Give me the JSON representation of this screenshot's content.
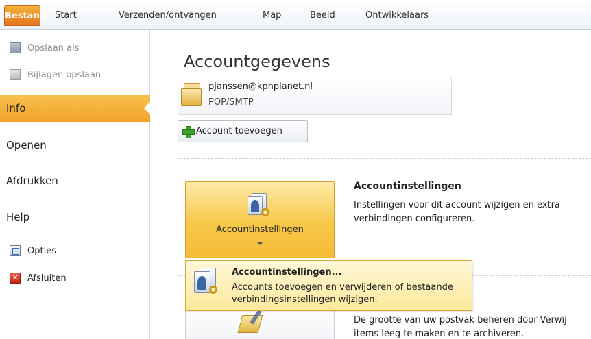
{
  "ribbon": {
    "tabs": [
      "Bestand",
      "Start",
      "Verzenden/ontvangen",
      "Map",
      "Beeld",
      "Ontwikkelaars"
    ]
  },
  "nav": {
    "save_as": "Opslaan als",
    "save_attachments": "Bijlagen opslaan",
    "info": "Info",
    "open": "Openen",
    "print": "Afdrukken",
    "help": "Help",
    "options": "Opties",
    "exit": "Afsluiten"
  },
  "main": {
    "title": "Accountgegevens",
    "account": {
      "email": "pjanssen@kpnplanet.nl",
      "type": "POP/SMTP"
    },
    "add_account_label": "Account toevoegen",
    "account_settings": {
      "button_label": "Accountinstellingen",
      "title": "Accountinstellingen",
      "description": "Instellingen voor dit account wijzigen en extra verbindingen configureren."
    },
    "dropdown_menu": {
      "item_title": "Accountinstellingen...",
      "item_description": "Accounts toevoegen en verwijderen of bestaande verbindingsinstellingen wijzigen."
    },
    "mailbox_cleanup": {
      "description_line1": "De grootte van uw postvak beheren door Verwij",
      "description_line2": "items leeg te maken en te archiveren."
    }
  },
  "colors": {
    "file_tab": "#e2741c",
    "info_highlight": "#f2a12a",
    "button_gold": "#f7c849"
  }
}
